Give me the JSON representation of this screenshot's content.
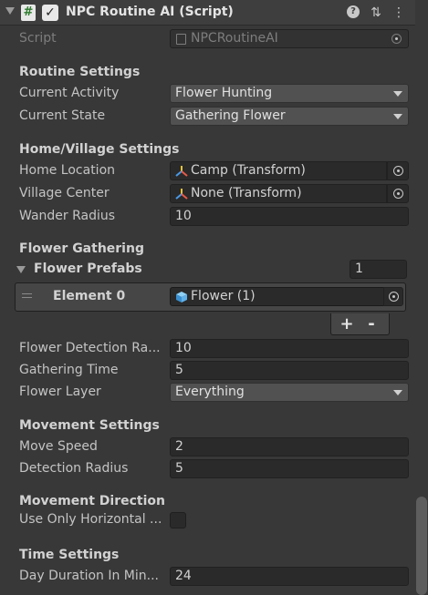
{
  "header": {
    "component_title": "NPC Routine AI (Script)",
    "script_glyph": "#",
    "check_glyph": "✓",
    "help_glyph": "?",
    "presets_glyph": "⇅",
    "menu_glyph": "⋮"
  },
  "script": {
    "label": "Script",
    "value": "NPCRoutineAI"
  },
  "routine": {
    "title": "Routine Settings",
    "current_activity": {
      "label": "Current Activity",
      "value": "Flower Hunting"
    },
    "current_state": {
      "label": "Current State",
      "value": "Gathering Flower"
    }
  },
  "home_village": {
    "title": "Home/Village Settings",
    "home_location": {
      "label": "Home Location",
      "value": "Camp (Transform)"
    },
    "village_center": {
      "label": "Village Center",
      "value": "None (Transform)"
    },
    "wander_radius": {
      "label": "Wander Radius",
      "value": "10"
    }
  },
  "flower": {
    "title": "Flower Gathering",
    "prefabs": {
      "label": "Flower Prefabs",
      "size": "1",
      "elements": [
        {
          "label": "Element 0",
          "value": "Flower (1)"
        }
      ],
      "add_glyph": "+",
      "remove_glyph": "-"
    },
    "detection_range": {
      "label": "Flower Detection Ra...",
      "value": "10"
    },
    "gathering_time": {
      "label": "Gathering Time",
      "value": "5"
    },
    "flower_layer": {
      "label": "Flower Layer",
      "value": "Everything"
    }
  },
  "movement": {
    "title": "Movement Settings",
    "move_speed": {
      "label": "Move Speed",
      "value": "2"
    },
    "detection_radius": {
      "label": "Detection Radius",
      "value": "5"
    }
  },
  "direction": {
    "title": "Movement Direction",
    "use_only_horizontal": {
      "label": "Use Only Horizontal ...",
      "checked": false
    }
  },
  "time": {
    "title": "Time Settings",
    "day_duration": {
      "label": "Day Duration In Min...",
      "value": "24"
    }
  },
  "colors": {
    "background": "#383838",
    "header": "#3e3e3e",
    "field": "#2a2a2a",
    "dropdown": "#515151",
    "text": "#c4c4c4"
  }
}
